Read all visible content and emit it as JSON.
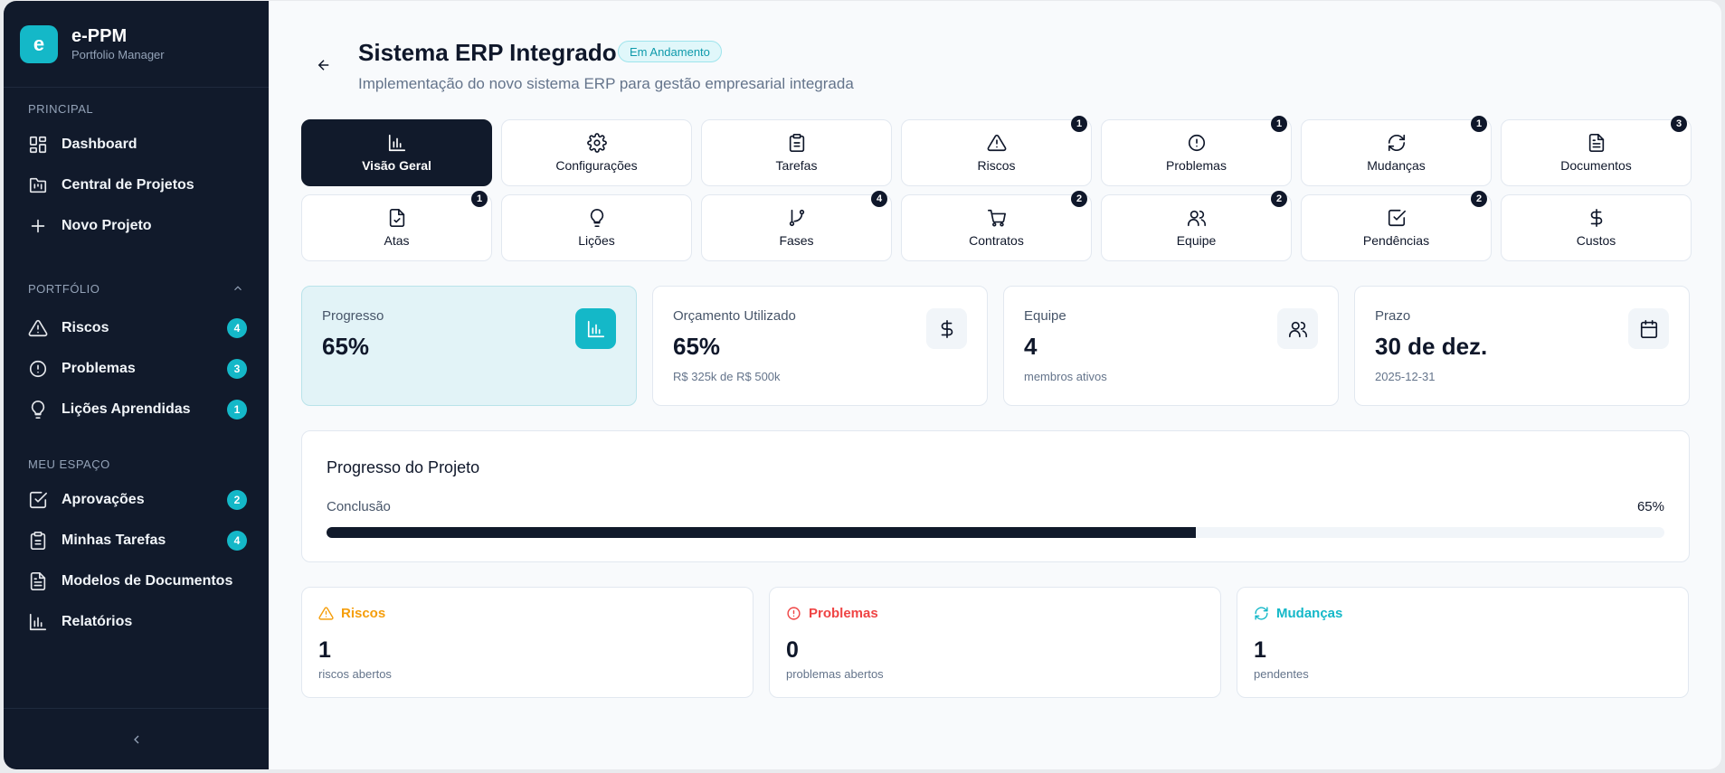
{
  "brand": {
    "logo_letter": "e",
    "title": "e-PPM",
    "subtitle": "Portfolio Manager"
  },
  "sidebar": {
    "sections": [
      {
        "label": "PRINCIPAL",
        "items": [
          {
            "label": "Dashboard",
            "icon": "layout-grid-icon"
          },
          {
            "label": "Central de Projetos",
            "icon": "folder-kanban-icon"
          },
          {
            "label": "Novo Projeto",
            "icon": "plus-icon"
          }
        ]
      },
      {
        "label": "PORTFÓLIO",
        "items": [
          {
            "label": "Riscos",
            "icon": "alert-triangle-icon",
            "badge": "4"
          },
          {
            "label": "Problemas",
            "icon": "alert-circle-icon",
            "badge": "3"
          },
          {
            "label": "Lições Aprendidas",
            "icon": "lightbulb-icon",
            "badge": "1"
          }
        ]
      },
      {
        "label": "MEU ESPAÇO",
        "items": [
          {
            "label": "Aprovações",
            "icon": "check-square-icon",
            "badge": "2"
          },
          {
            "label": "Minhas Tarefas",
            "icon": "clipboard-icon",
            "badge": "4"
          },
          {
            "label": "Modelos de Documentos",
            "icon": "file-text-icon"
          },
          {
            "label": "Relatórios",
            "icon": "bar-chart-icon"
          }
        ]
      }
    ]
  },
  "header": {
    "title": "Sistema ERP Integrado",
    "status": "Em Andamento",
    "subtitle": "Implementação do novo sistema ERP para gestão empresarial integrada"
  },
  "tabs": [
    {
      "label": "Visão Geral",
      "icon": "bar-chart-icon",
      "badge": ""
    },
    {
      "label": "Configurações",
      "icon": "gear-icon",
      "badge": ""
    },
    {
      "label": "Tarefas",
      "icon": "clipboard-icon",
      "badge": ""
    },
    {
      "label": "Riscos",
      "icon": "alert-triangle-icon",
      "badge": "1"
    },
    {
      "label": "Problemas",
      "icon": "alert-circle-icon",
      "badge": "1"
    },
    {
      "label": "Mudanças",
      "icon": "refresh-icon",
      "badge": "1"
    },
    {
      "label": "Documentos",
      "icon": "file-text-icon",
      "badge": "3"
    },
    {
      "label": "Atas",
      "icon": "file-check-icon",
      "badge": "1"
    },
    {
      "label": "Lições",
      "icon": "lightbulb-icon",
      "badge": ""
    },
    {
      "label": "Fases",
      "icon": "git-branch-icon",
      "badge": "4"
    },
    {
      "label": "Contratos",
      "icon": "cart-icon",
      "badge": "2"
    },
    {
      "label": "Equipe",
      "icon": "users-icon",
      "badge": "2"
    },
    {
      "label": "Pendências",
      "icon": "check-square-icon",
      "badge": "2"
    },
    {
      "label": "Custos",
      "icon": "dollar-icon",
      "badge": ""
    }
  ],
  "stats": [
    {
      "label": "Progresso",
      "value": "65%",
      "sub": "",
      "icon": "bar-chart-icon"
    },
    {
      "label": "Orçamento Utilizado",
      "value": "65%",
      "sub": "R$ 325k de R$ 500k",
      "icon": "dollar-icon"
    },
    {
      "label": "Equipe",
      "value": "4",
      "sub": "membros ativos",
      "icon": "users-icon"
    },
    {
      "label": "Prazo",
      "value": "30 de dez.",
      "sub": "2025-12-31",
      "icon": "calendar-icon"
    }
  ],
  "progress": {
    "title": "Progresso do Projeto",
    "label": "Conclusão",
    "value_text": "65%",
    "percent": 65
  },
  "summary": [
    {
      "title": "Riscos",
      "value": "1",
      "sub": "riscos abertos",
      "color": "#f59e0b",
      "icon": "alert-triangle-icon"
    },
    {
      "title": "Problemas",
      "value": "0",
      "sub": "problemas abertos",
      "color": "#ef4444",
      "icon": "alert-circle-icon"
    },
    {
      "title": "Mudanças",
      "value": "1",
      "sub": "pendentes",
      "color": "#14b8c8",
      "icon": "refresh-icon"
    }
  ]
}
